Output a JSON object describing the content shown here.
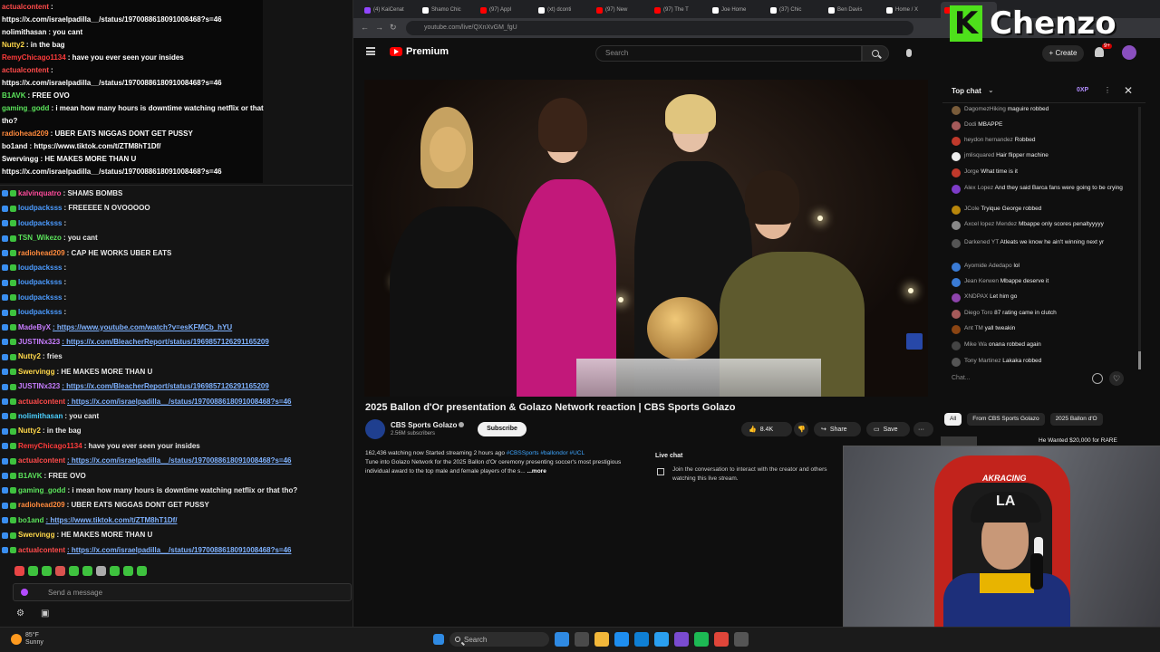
{
  "stream_chat": {
    "overlay_lines": [
      {
        "user": "actualcontent",
        "msg": ":",
        "color": "#ff4b4b"
      },
      {
        "user": "",
        "msg": "https://x.com/israelpadilla__/status/1970088618091008468?s=46",
        "color": "#ffffff",
        "link": false
      },
      {
        "user": "nolimithasan",
        "msg": ": you cant",
        "color": "#ffffff"
      },
      {
        "user": "Nutty2",
        "msg": ": in the bag",
        "color": "#ffd84a"
      },
      {
        "user": "RemyChicago1134",
        "msg": ": have you ever seen your insides",
        "color": "#ff3b3b"
      },
      {
        "user": "actualcontent",
        "msg": ":",
        "color": "#ff4b4b"
      },
      {
        "user": "",
        "msg": "https://x.com/israelpadilla__/status/1970088618091008468?s=46",
        "color": "#ffffff"
      },
      {
        "user": "B1AVK",
        "msg": ": FREE OVO",
        "color": "#5be35b"
      },
      {
        "user": "gaming_godd",
        "msg": ": i mean how many hours is downtime watching netflix or that",
        "color": "#5be35b"
      },
      {
        "user": "",
        "msg": "tho?",
        "color": "#ffffff"
      },
      {
        "user": "radiohead209",
        "msg": ": UBER EATS NIGGAS DONT GET PUSSY",
        "color": "#ff8a3d"
      },
      {
        "user": "bo1and",
        "msg": ": https://www.tiktok.com/t/ZTM8hT1Df/",
        "color": "#ffffff"
      },
      {
        "user": "Swervingg",
        "msg": ": HE MAKES MORE THAN U",
        "color": "#ffffff"
      },
      {
        "user": "",
        "msg": "https://x.com/israelpadilla__/status/1970088618091008468?s=46",
        "color": "#ffffff"
      }
    ],
    "lines": [
      {
        "user": "kalvinquatro",
        "msg": ": SHAMS BOMBS",
        "color": "#ff4b9b",
        "link": false
      },
      {
        "user": "loudpacksss",
        "msg": ": FREEEEE N OVOOOOO",
        "color": "#4b9bff",
        "link": false
      },
      {
        "user": "loudpacksss",
        "msg": ":",
        "color": "#4b9bff",
        "link": false
      },
      {
        "user": "TSN_Wikezo",
        "msg": ": you cant",
        "color": "#5be35b",
        "link": false
      },
      {
        "user": "radiohead209",
        "msg": ": CAP HE WORKS UBER EATS",
        "color": "#ff8a3d",
        "link": false
      },
      {
        "user": "loudpacksss",
        "msg": ":",
        "color": "#4b9bff",
        "link": false
      },
      {
        "user": "loudpacksss",
        "msg": ":",
        "color": "#4b9bff",
        "link": false
      },
      {
        "user": "loudpacksss",
        "msg": ":",
        "color": "#4b9bff",
        "link": false
      },
      {
        "user": "loudpacksss",
        "msg": ":",
        "color": "#4b9bff",
        "link": false
      },
      {
        "user": "MadeByX",
        "msg": ": https://www.youtube.com/watch?v=esKFMCb_hYU",
        "color": "#c77dff",
        "link": true
      },
      {
        "user": "JUSTINx323",
        "msg": ": https://x.com/BleacherReport/status/1969857126291165209",
        "color": "#c77dff",
        "link": true
      },
      {
        "user": "Nutty2",
        "msg": ": fries",
        "color": "#ffd84a",
        "link": false
      },
      {
        "user": "Swervingg",
        "msg": ": HE MAKES MORE THAN U",
        "color": "#ffd84a",
        "link": false
      },
      {
        "user": "JUSTINx323",
        "msg": ": https://x.com/BleacherReport/status/1969857126291165209",
        "color": "#c77dff",
        "link": true
      },
      {
        "user": "actualcontent",
        "msg": ": https://x.com/israelpadilla__/status/1970088618091008468?s=46",
        "color": "#ff4b4b",
        "link": true
      },
      {
        "user": "nolimithasan",
        "msg": ": you cant",
        "color": "#4bd0ff",
        "link": false
      },
      {
        "user": "Nutty2",
        "msg": ": in the bag",
        "color": "#ffd84a",
        "link": false
      },
      {
        "user": "RemyChicago1134",
        "msg": ": have you ever seen your insides",
        "color": "#ff3b3b",
        "link": false
      },
      {
        "user": "actualcontent",
        "msg": ": https://x.com/israelpadilla__/status/1970088618091008468?s=46",
        "color": "#ff4b4b",
        "link": true
      },
      {
        "user": "B1AVK",
        "msg": ": FREE OVO",
        "color": "#5be35b",
        "link": false
      },
      {
        "user": "gaming_godd",
        "msg": ": i mean how many hours is downtime watching netflix or that tho?",
        "color": "#5be35b",
        "link": false
      },
      {
        "user": "radiohead209",
        "msg": ": UBER EATS NIGGAS DONT GET PUSSY",
        "color": "#ff8a3d",
        "link": false
      },
      {
        "user": "bo1and",
        "msg": ": https://www.tiktok.com/t/ZTM8hT1Df/",
        "color": "#5be35b",
        "link": true
      },
      {
        "user": "Swervingg",
        "msg": ": HE MAKES MORE THAN U",
        "color": "#ffd84a",
        "link": false
      },
      {
        "user": "actualcontent",
        "msg": ": https://x.com/israelpadilla__/status/1970088618091008468?s=46",
        "color": "#ff4b4b",
        "link": true
      }
    ],
    "send_placeholder": "Send a message",
    "emote_colors": [
      "#e84545",
      "#3ec23e",
      "#3ec23e",
      "#d9534f",
      "#3ec23e",
      "#3ec23e",
      "#aaaaaa",
      "#3ec23e",
      "#3ec23e",
      "#3ec23e"
    ]
  },
  "taskbar": {
    "weather_temp": "85°F",
    "weather_desc": "Sunny",
    "search_label": "Search",
    "icon_colors": [
      "#2f8ae3",
      "#4a4a4a",
      "#f2b73a",
      "#1e8ef0",
      "#0f7fd4",
      "#2a9ff0",
      "#7a4bd0",
      "#1db954",
      "#e0463a",
      "#555555"
    ]
  },
  "browser": {
    "tabs": [
      {
        "label": "(4) KaiCenat",
        "color": "#9146ff"
      },
      {
        "label": "Shamo Chic",
        "color": "#ffffff"
      },
      {
        "label": "(97) Appl",
        "color": "#ff0000"
      },
      {
        "label": "(xt) dconti",
        "color": "#ffffff"
      },
      {
        "label": "(97) New",
        "color": "#ff0000"
      },
      {
        "label": "(97) The T",
        "color": "#ff0000"
      },
      {
        "label": "Joe Home",
        "color": "#ffffff"
      },
      {
        "label": "(37) Chic",
        "color": "#ffffff"
      },
      {
        "label": "Ben Davis",
        "color": "#ffffff"
      },
      {
        "label": "Home / X",
        "color": "#ffffff"
      },
      {
        "label": "(37) 202",
        "color": "#ff0000"
      }
    ],
    "url": "youtube.com/live/QXnXvGM_fgU"
  },
  "youtube": {
    "brand": "Premium",
    "search_placeholder": "Search",
    "create_label": "+ Create",
    "notif_count": "9+",
    "video_title": "2025 Ballon d'Or presentation & Golazo Network reaction | CBS Sports Golazo",
    "channel_name": "CBS Sports Golazo",
    "channel_subs": "2.56M subscribers",
    "subscribe_label": "Subscribe",
    "like_count": "8.4K",
    "share_label": "Share",
    "save_label": "Save",
    "more_label": "···",
    "description": {
      "stats": "162,436 watching now  Started streaming 2 hours ago ",
      "tags": "#CBSSports #ballondor #UCL",
      "text": "Tune into Golazo Network for the 2025 Ballon d'Or ceremony presenting soccer's most prestigious individual award to the top male and female players of the s...",
      "more": "...more"
    },
    "live_chat_label": "Live chat",
    "live_chat_note": "Join the conversation to interact with the creator and others watching this live stream.",
    "chips": [
      "All",
      "From CBS Sports Golazo",
      "2025 Ballon d'O"
    ],
    "related_title": "He Wanted $20,000 for RARE"
  },
  "live_chat": {
    "title": "Top chat",
    "xp": "0XP",
    "input_placeholder": "Chat...",
    "messages": [
      {
        "name": "DagomezHiking",
        "msg": "maguire robbed",
        "color": "#7a5c3a"
      },
      {
        "name": "Dodi",
        "msg": "MBAPPE",
        "color": "#a55a5a"
      },
      {
        "name": "heydon hernandez",
        "msg": "Robbed",
        "color": "#c0392b"
      },
      {
        "name": "jmlisquared",
        "msg": "Hair flipper machine",
        "color": "#eeeeee"
      },
      {
        "name": "Jorge",
        "msg": "What time is it",
        "color": "#c0392b"
      },
      {
        "name": "Alex Lopez",
        "msg": "And they said Barca fans were going to be crying",
        "color": "#7d3cc8"
      },
      {
        "name": "JCole",
        "msg": "Tryique George robbed",
        "color": "#b8860b"
      },
      {
        "name": "Axcel lopez Mendez",
        "msg": "Mbappe only scores penaltyyyyy",
        "color": "#888888"
      },
      {
        "name": "Darkened YT",
        "msg": "Atleats we know he ain't winning next yr",
        "color": "#555555"
      },
      {
        "name": "Ayomide Adedapo",
        "msg": "lol",
        "color": "#3a7bd5"
      },
      {
        "name": "Jean Kerwen",
        "msg": "Mbappe deserve it",
        "color": "#3a7bd5"
      },
      {
        "name": "XNDPAX",
        "msg": "Let him go",
        "color": "#8e44ad"
      },
      {
        "name": "Diego Toro",
        "msg": "87 rating came in clutch",
        "color": "#a55a5a"
      },
      {
        "name": "Ant TM",
        "msg": "yall tweakin",
        "color": "#8b4513"
      },
      {
        "name": "Mike Wa",
        "msg": "onana robbed again",
        "color": "#444444"
      },
      {
        "name": "Tony Martinez",
        "msg": "Lakaka robbed",
        "color": "#555555"
      }
    ]
  },
  "overlay": {
    "logo_letter": "K",
    "logo_text": "Chenzo",
    "cap_logo": "LA",
    "chair_brand": "AKRACING"
  }
}
